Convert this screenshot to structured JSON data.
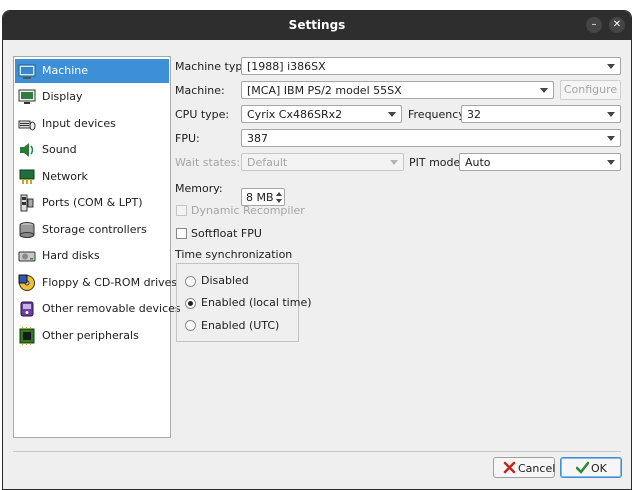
{
  "window": {
    "title": "Settings",
    "minimize_glyph": "–",
    "close_glyph": "✕"
  },
  "sidebar": {
    "items": [
      {
        "label": "Machine",
        "icon": "machine-icon",
        "selected": true
      },
      {
        "label": "Display",
        "icon": "display-icon"
      },
      {
        "label": "Input devices",
        "icon": "input-devices-icon"
      },
      {
        "label": "Sound",
        "icon": "sound-icon"
      },
      {
        "label": "Network",
        "icon": "network-icon"
      },
      {
        "label": "Ports (COM & LPT)",
        "icon": "ports-icon"
      },
      {
        "label": "Storage controllers",
        "icon": "storage-controllers-icon"
      },
      {
        "label": "Hard disks",
        "icon": "hard-disks-icon"
      },
      {
        "label": "Floppy & CD-ROM drives",
        "icon": "floppy-cdrom-icon"
      },
      {
        "label": "Other removable devices",
        "icon": "removable-devices-icon"
      },
      {
        "label": "Other peripherals",
        "icon": "peripherals-icon"
      }
    ]
  },
  "machine": {
    "machine_type_label": "Machine type:",
    "machine_type_value": "[1988] i386SX",
    "machine_label": "Machine:",
    "machine_value": "[MCA] IBM PS/2 model 55SX",
    "configure_label": "Configure",
    "cpu_type_label": "CPU type:",
    "cpu_type_value": "Cyrix Cx486SRx2",
    "frequency_label": "Frequency:",
    "frequency_value": "32",
    "fpu_label": "FPU:",
    "fpu_value": "387",
    "wait_states_label": "Wait states:",
    "wait_states_value": "Default",
    "pit_mode_label": "PIT mode:",
    "pit_mode_value": "Auto",
    "memory_label": "Memory:",
    "memory_value": "8 MB",
    "dynamic_recompiler_label": "Dynamic Recompiler",
    "softfloat_label": "Softfloat FPU",
    "time_sync_label": "Time synchronization",
    "time_sync_options": [
      "Disabled",
      "Enabled (local time)",
      "Enabled (UTC)"
    ],
    "time_sync_selected": "Enabled (local time)"
  },
  "buttons": {
    "cancel_label": "Cancel",
    "ok_label": "OK"
  },
  "colors": {
    "accent": "#3d8fd6",
    "titlebar": "#2e2e2e"
  }
}
